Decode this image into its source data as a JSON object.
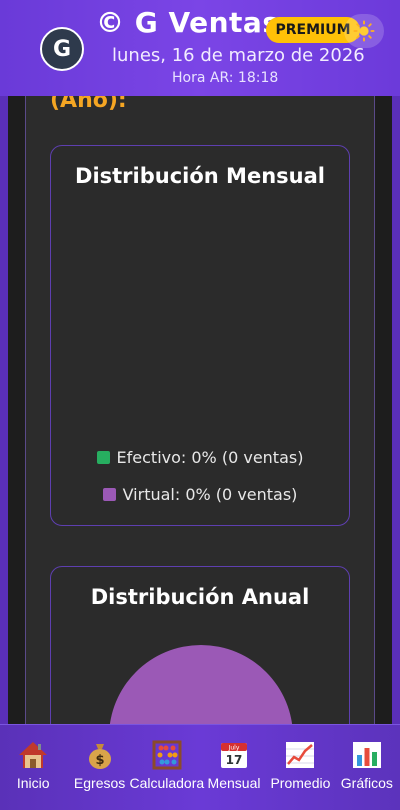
{
  "header": {
    "avatar_letter": "G",
    "title": "© G Ventas",
    "badge": "PREMIUM",
    "date": "lunes, 16 de marzo de 2026",
    "time": "Hora AR: 18:18"
  },
  "main": {
    "section_heading": "(Año):",
    "monthly_card": {
      "title": "Distribución Mensual",
      "legend": [
        {
          "label": "Efectivo: 0% (0 ventas)",
          "color": "#27ae60"
        },
        {
          "label": "Virtual: 0% (0 ventas)",
          "color": "#9b59b6"
        }
      ]
    },
    "annual_card": {
      "title": "Distribución Anual",
      "pie_color": "#9b59b6"
    }
  },
  "nav": {
    "items": [
      {
        "label": "Inicio",
        "icon": "house-icon"
      },
      {
        "label": "Egresos",
        "icon": "money-bag-icon"
      },
      {
        "label": "Calculadora",
        "icon": "abacus-icon"
      },
      {
        "label": "Mensual",
        "icon": "calendar-icon"
      },
      {
        "label": "Promedio",
        "icon": "line-chart-icon"
      },
      {
        "label": "Gráficos",
        "icon": "bar-chart-icon"
      }
    ],
    "calendar_month": "July",
    "calendar_day": "17"
  },
  "colors": {
    "accent": "#6a3ad8",
    "premium": "#ffc107",
    "heading_orange": "#f5a623",
    "card_border": "#5e3fb0"
  }
}
